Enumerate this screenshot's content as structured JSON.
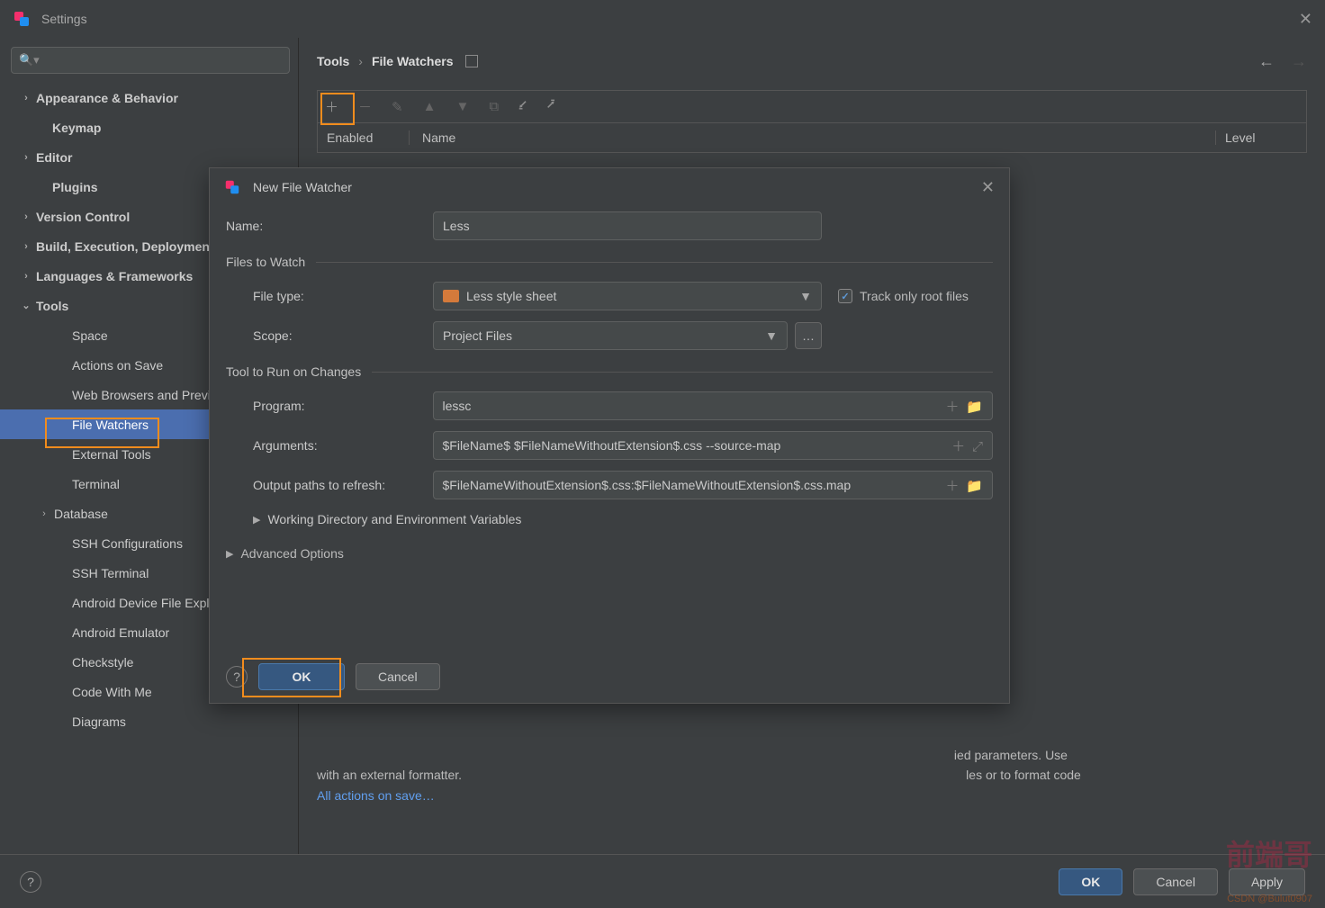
{
  "window": {
    "title": "Settings"
  },
  "breadcrumb": {
    "a": "Tools",
    "b": "File Watchers"
  },
  "table": {
    "col_enabled": "Enabled",
    "col_name": "Name",
    "col_level": "Level"
  },
  "sidebar": {
    "items": [
      {
        "label": "Appearance & Behavior",
        "chev": true,
        "bold": true,
        "indent": 0
      },
      {
        "label": "Keymap",
        "chev": false,
        "bold": true,
        "indent": 1
      },
      {
        "label": "Editor",
        "chev": true,
        "bold": true,
        "indent": 0
      },
      {
        "label": "Plugins",
        "chev": false,
        "bold": true,
        "indent": 1
      },
      {
        "label": "Version Control",
        "chev": true,
        "bold": true,
        "indent": 0
      },
      {
        "label": "Build, Execution, Deployment",
        "chev": true,
        "bold": true,
        "indent": 0
      },
      {
        "label": "Languages & Frameworks",
        "chev": true,
        "bold": true,
        "indent": 0
      },
      {
        "label": "Tools",
        "chev": true,
        "bold": true,
        "open": true,
        "indent": 0
      },
      {
        "label": "Space",
        "indent": 2
      },
      {
        "label": "Actions on Save",
        "indent": 2
      },
      {
        "label": "Web Browsers and Preview",
        "indent": 2
      },
      {
        "label": "File Watchers",
        "indent": 2,
        "selected": true
      },
      {
        "label": "External Tools",
        "indent": 2
      },
      {
        "label": "Terminal",
        "indent": 2
      },
      {
        "label": "Database",
        "chev": true,
        "indent": 2,
        "chevpos": 1
      },
      {
        "label": "SSH Configurations",
        "indent": 2
      },
      {
        "label": "SSH Terminal",
        "indent": 2
      },
      {
        "label": "Android Device File Explorer",
        "indent": 2
      },
      {
        "label": "Android Emulator",
        "indent": 2
      },
      {
        "label": "Checkstyle",
        "indent": 2
      },
      {
        "label": "Code With Me",
        "indent": 2
      },
      {
        "label": "Diagrams",
        "indent": 2
      }
    ]
  },
  "hint": {
    "l1": "                                                                                                                                                                                      ied parameters. Use",
    "l2": "with an external formatter.                                                                                                                                                les or to format code",
    "link": "All actions on save…"
  },
  "buttons": {
    "ok": "OK",
    "cancel": "Cancel",
    "apply": "Apply"
  },
  "modal": {
    "title": "New File Watcher",
    "name_label": "Name:",
    "name_value": "Less",
    "sects": {
      "ftw": "Files to Watch",
      "trc": "Tool to Run on Changes"
    },
    "ft_label": "File type:",
    "ft_value": "Less style sheet",
    "track": "Track only root files",
    "scope_label": "Scope:",
    "scope_value": "Project Files",
    "scope_btn": "…",
    "prog_label": "Program:",
    "prog_value": "lessc",
    "args_label": "Arguments:",
    "args_value": "$FileName$ $FileNameWithoutExtension$.css --source-map",
    "out_label": "Output paths to refresh:",
    "out_value": "$FileNameWithoutExtension$.css:$FileNameWithoutExtension$.css.map",
    "wd": "Working Directory and Environment Variables",
    "adv": "Advanced Options"
  },
  "watermark": {
    "cn": "前端哥",
    "csdn": "CSDN @Bulut0907"
  }
}
